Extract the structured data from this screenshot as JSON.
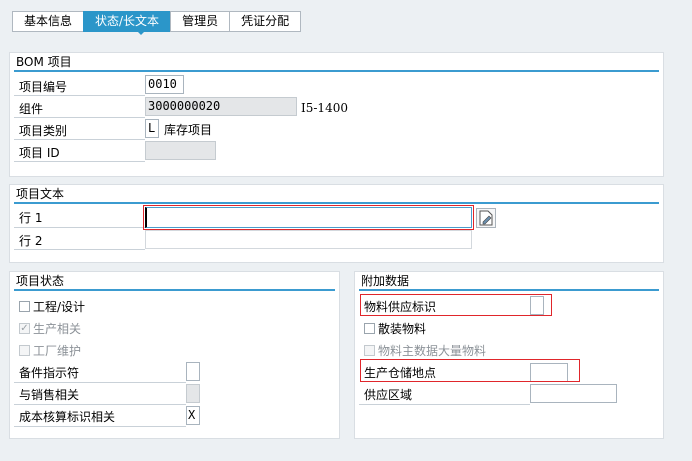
{
  "tabs": [
    {
      "label": "基本信息"
    },
    {
      "label": "状态/长文本"
    },
    {
      "label": "管理员"
    },
    {
      "label": "凭证分配"
    }
  ],
  "bom_item": {
    "title": "BOM 项目",
    "item_number_label": "项目编号",
    "item_number": "0010",
    "component_label": "组件",
    "component": "3000000020",
    "component_desc": "I5-1400",
    "item_category_label": "项目类别",
    "item_category": "L",
    "item_category_desc": "库存项目",
    "item_id_label": "项目 ID",
    "item_id": ""
  },
  "item_text": {
    "title": "项目文本",
    "line1_label": "行 1",
    "line1_value": "",
    "line2_label": "行 2",
    "line2_value": ""
  },
  "item_status": {
    "title": "项目状态",
    "engineering_label": "工程/设计",
    "engineering_checked": false,
    "production_label": "生产相关",
    "production_checked": true,
    "plant_maint_label": "工厂维护",
    "plant_maint_checked": false,
    "spare_part_label": "备件指示符",
    "spare_part_value": "",
    "sales_label": "与销售相关",
    "sales_value": "",
    "costing_label": "成本核算标识相关",
    "costing_value": "X"
  },
  "additional_data": {
    "title": "附加数据",
    "material_provision_label": "物料供应标识",
    "material_provision_value": "",
    "bulk_material_label": "散装物料",
    "bulk_material_checked": false,
    "bulk_material_master_label": "物料主数据大量物料",
    "bulk_material_master_checked": false,
    "prod_storage_label": "生产仓储地点",
    "prod_storage_value": "",
    "supply_area_label": "供应区域",
    "supply_area_value": ""
  },
  "colors": {
    "accent": "#2b96c9",
    "highlight_border": "#e0262b",
    "background": "#ecf0f3"
  }
}
